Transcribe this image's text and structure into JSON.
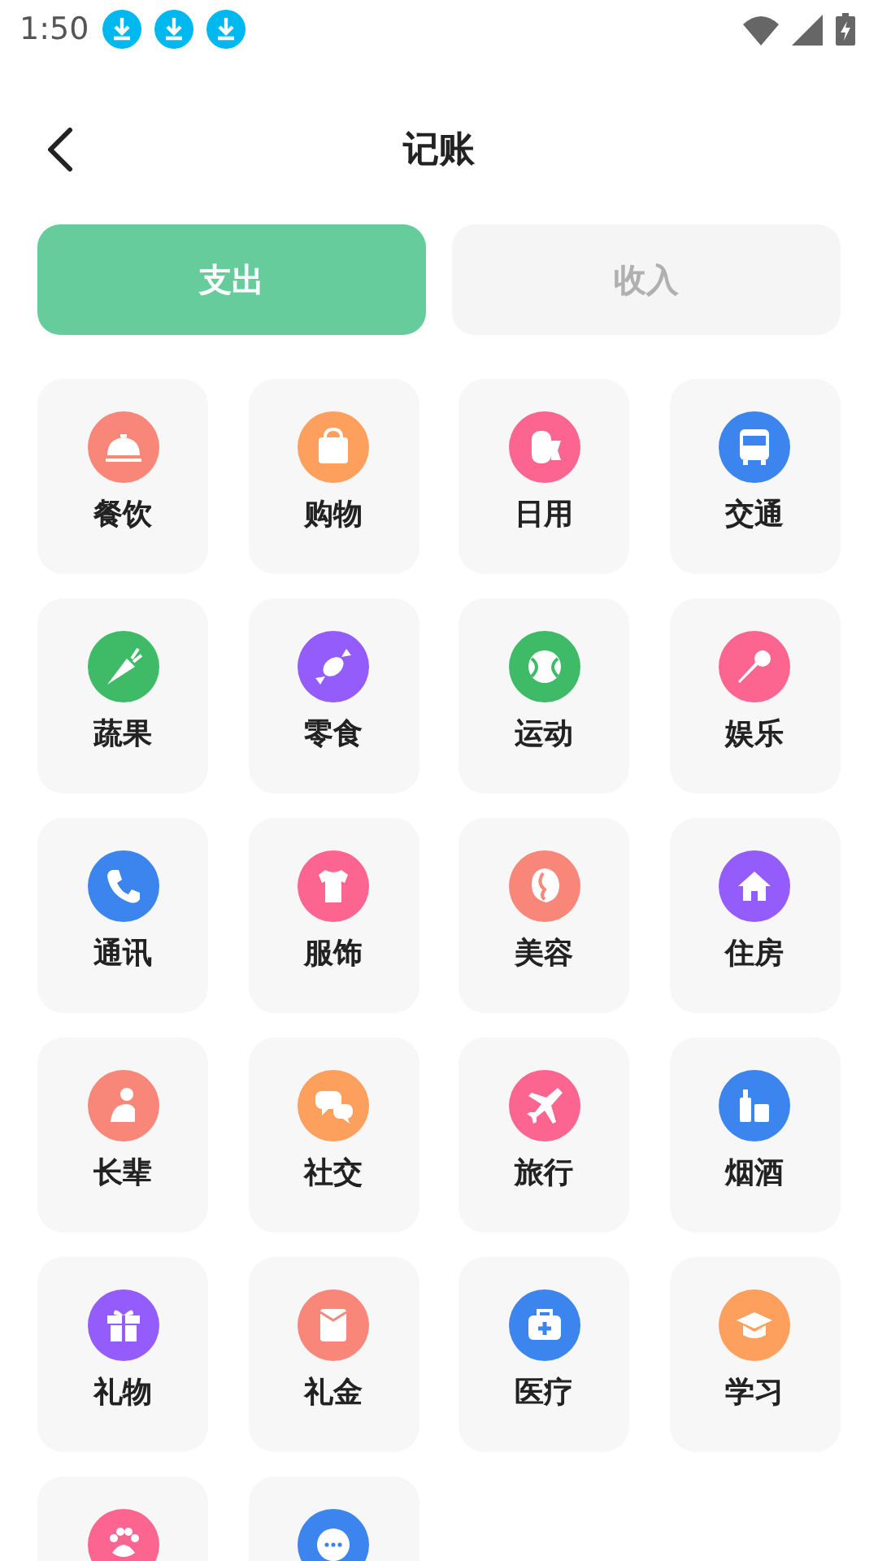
{
  "status_bar": {
    "time": "1:50"
  },
  "header": {
    "title": "记账"
  },
  "tabs": [
    {
      "label": "支出",
      "selected": true
    },
    {
      "label": "收入",
      "selected": false
    }
  ],
  "categories": [
    {
      "label": "餐饮",
      "color": "#f8877a"
    },
    {
      "label": "购物",
      "color": "#fda05e"
    },
    {
      "label": "日用",
      "color": "#fb6590"
    },
    {
      "label": "交通",
      "color": "#3d85ee"
    },
    {
      "label": "蔬果",
      "color": "#3fba66"
    },
    {
      "label": "零食",
      "color": "#945cfb"
    },
    {
      "label": "运动",
      "color": "#3fba66"
    },
    {
      "label": "娱乐",
      "color": "#fb6590"
    },
    {
      "label": "通讯",
      "color": "#3d85ee"
    },
    {
      "label": "服饰",
      "color": "#fb6590"
    },
    {
      "label": "美容",
      "color": "#f8877a"
    },
    {
      "label": "住房",
      "color": "#945cfb"
    },
    {
      "label": "长辈",
      "color": "#f8877a"
    },
    {
      "label": "社交",
      "color": "#fda05e"
    },
    {
      "label": "旅行",
      "color": "#fb6590"
    },
    {
      "label": "烟酒",
      "color": "#3d85ee"
    },
    {
      "label": "礼物",
      "color": "#945cfb"
    },
    {
      "label": "礼金",
      "color": "#f8877a"
    },
    {
      "label": "医疗",
      "color": "#3d85ee"
    },
    {
      "label": "学习",
      "color": "#fda05e"
    },
    {
      "color": "#fb6590"
    },
    {
      "color": "#3d85ee"
    }
  ]
}
